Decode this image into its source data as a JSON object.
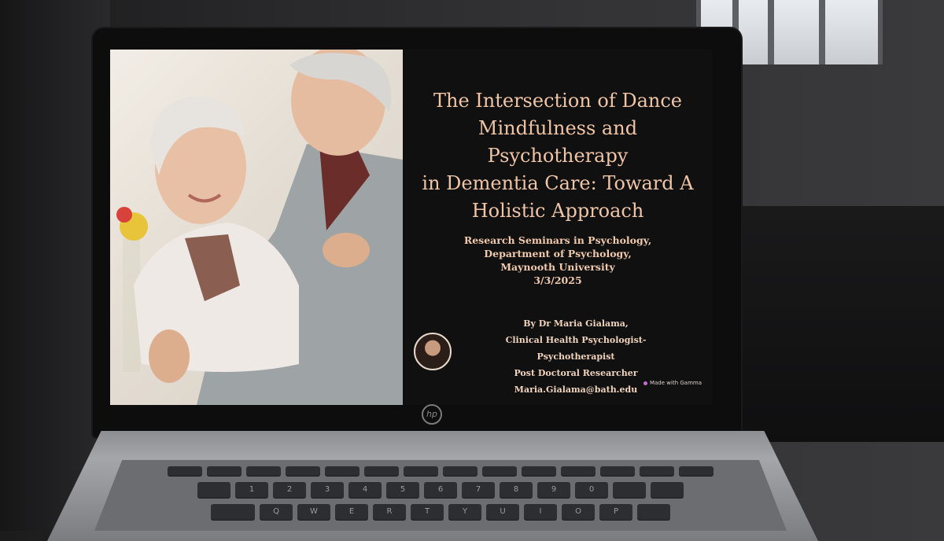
{
  "slide": {
    "title_lines": [
      "The Intersection of Dance",
      "Mindfulness and Psychotherapy",
      "in Dementia Care: Toward A",
      "Holistic Approach"
    ],
    "seminar_lines": [
      "Research Seminars in Psychology,",
      "Department of Psychology,",
      "Maynooth University",
      "3/3/2025"
    ],
    "author_lines": [
      "By Dr Maria Gialama,",
      "Clinical Health Psychologist- Psychotherapist",
      "Post Doctoral Researcher",
      "Maria.Gialama@bath.edu"
    ],
    "badge": "Made with Gamma"
  },
  "laptop": {
    "logo": "hp",
    "number_row": [
      "1",
      "2",
      "3",
      "4",
      "5",
      "6",
      "7",
      "8",
      "9",
      "0"
    ],
    "letter_row": [
      "Q",
      "W",
      "E",
      "R",
      "T",
      "Y",
      "U",
      "I",
      "O",
      "P"
    ]
  },
  "colors": {
    "title": "#f0c5a6",
    "slide_background": "#101011",
    "photo_background": "#ece6dd"
  }
}
